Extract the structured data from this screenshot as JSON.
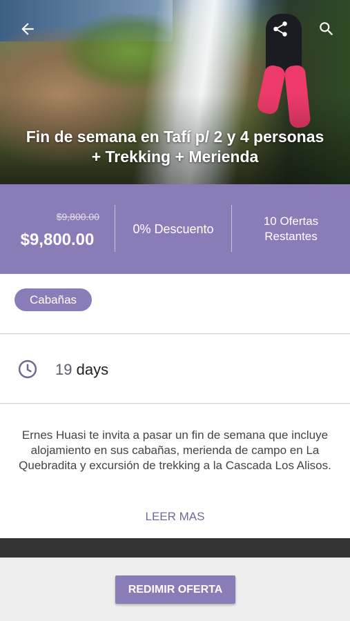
{
  "header": {
    "title": "Fin de semana en Tafí p/ 2 y 4 personas + Trekking + Merienda",
    "back_icon": "arrow-back-icon",
    "share_icon": "share-icon",
    "search_icon": "search-icon"
  },
  "pricing": {
    "original_price": "$9,800.00",
    "current_price": "$9,800.00",
    "discount": "0% Descuento",
    "remaining": "10 Ofertas Restantes"
  },
  "category": {
    "label": "Cabañas"
  },
  "duration": {
    "icon": "clock-icon",
    "number": "19",
    "unit": "days"
  },
  "description": {
    "text": "Ernes Huasi te invita a pasar un fin de semana que incluye alojamiento en sus cabañas, merienda de campo en La Quebradita y excursión de trekking a la Cascada Los Alisos.",
    "read_more": "LEER MAS"
  },
  "actions": {
    "redeem_label": "REDIMIR OFERTA"
  },
  "colors": {
    "accent": "#8a7db7",
    "read_more": "#6f6a93"
  }
}
